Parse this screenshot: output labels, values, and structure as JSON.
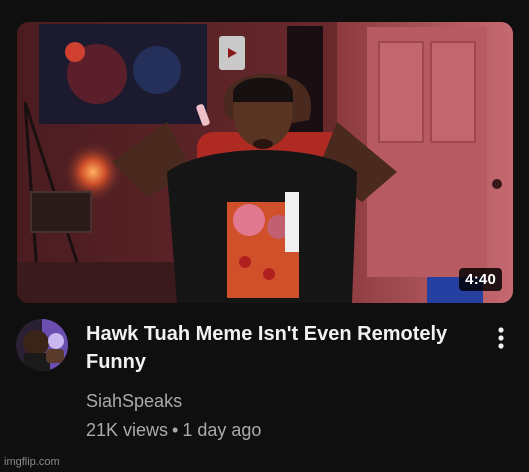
{
  "video": {
    "duration": "4:40",
    "title": "Hawk Tuah Meme Isn't Even Remotely Funny",
    "channel": "SiahSpeaks",
    "views": "21K views",
    "separator": "•",
    "age": "1 day ago"
  },
  "icons": {
    "menu": "more-vert-icon",
    "avatar": "channel-avatar"
  },
  "watermark": "imgflip.com",
  "colors": {
    "background": "#0f0f0f",
    "title": "#f1f1f1",
    "meta": "#aaaaaa"
  }
}
